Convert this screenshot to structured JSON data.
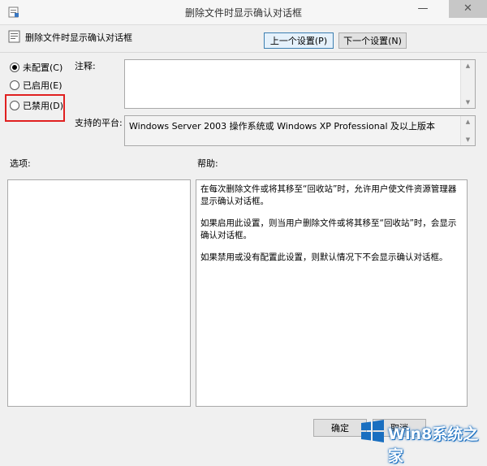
{
  "window": {
    "title": "删除文件时显示确认对话框",
    "minimize_glyph": "—",
    "close_glyph": "✕"
  },
  "header": {
    "policy_name": "删除文件时显示确认对话框"
  },
  "nav": {
    "prev_label": "上一个设置(P)",
    "next_label": "下一个设置(N)"
  },
  "state": {
    "options": [
      {
        "label": "未配置(C)",
        "selected": true
      },
      {
        "label": "已启用(E)",
        "selected": false
      },
      {
        "label": "已禁用(D)",
        "selected": false
      }
    ]
  },
  "comment": {
    "label": "注释:",
    "value": ""
  },
  "platform": {
    "label": "支持的平台:",
    "value": "Windows Server 2003 操作系统或 Windows XP Professional 及以上版本"
  },
  "options_panel": {
    "label": "选项:"
  },
  "help_panel": {
    "label": "帮助:",
    "paragraphs": [
      "在每次删除文件或将其移至“回收站”时，允许用户使文件资源管理器显示确认对话框。",
      "如果启用此设置，则当用户删除文件或将其移至“回收站”时，会显示确认对话框。",
      "如果禁用或没有配置此设置，则默认情况下不会显示确认对话框。"
    ]
  },
  "footer": {
    "ok_label": "确定",
    "cancel_label": "取消"
  },
  "watermark": {
    "text": "Win8系统之家"
  },
  "colors": {
    "highlight": "#e02020",
    "watermark": "#1a6fc0"
  }
}
